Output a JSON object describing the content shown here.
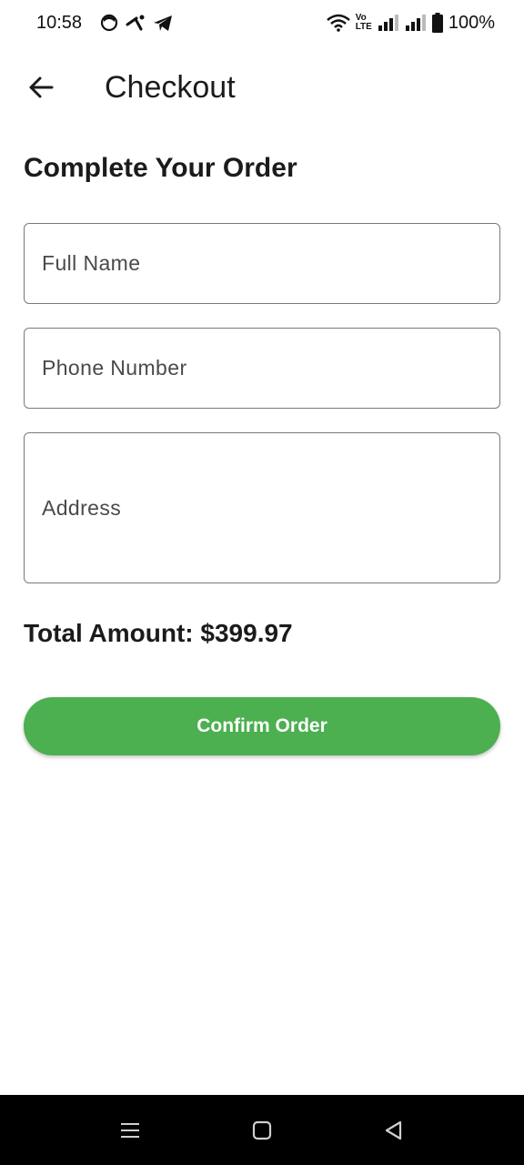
{
  "status_bar": {
    "time": "10:58",
    "battery_percent": "100%",
    "network_label_top": "Vo",
    "network_label_bottom": "LTE",
    "icons": [
      "face-notification-icon",
      "cross-notification-icon",
      "telegram-icon",
      "wifi-icon",
      "volte-icon",
      "signal-icon",
      "signal-icon",
      "battery-icon"
    ]
  },
  "app_bar": {
    "title": "Checkout",
    "back_icon": "arrow-left-icon"
  },
  "form": {
    "heading": "Complete Your Order",
    "full_name_placeholder": "Full Name",
    "phone_placeholder": "Phone Number",
    "address_placeholder": "Address"
  },
  "order": {
    "total_label": "Total Amount: $399.97",
    "confirm_label": "Confirm Order"
  },
  "colors": {
    "accent": "#4caf50",
    "nav_bar": "#000000",
    "field_border": "#7a7a7a"
  },
  "nav_bar": {
    "icons": [
      "menu-icon",
      "home-icon",
      "back-triangle-icon"
    ]
  }
}
